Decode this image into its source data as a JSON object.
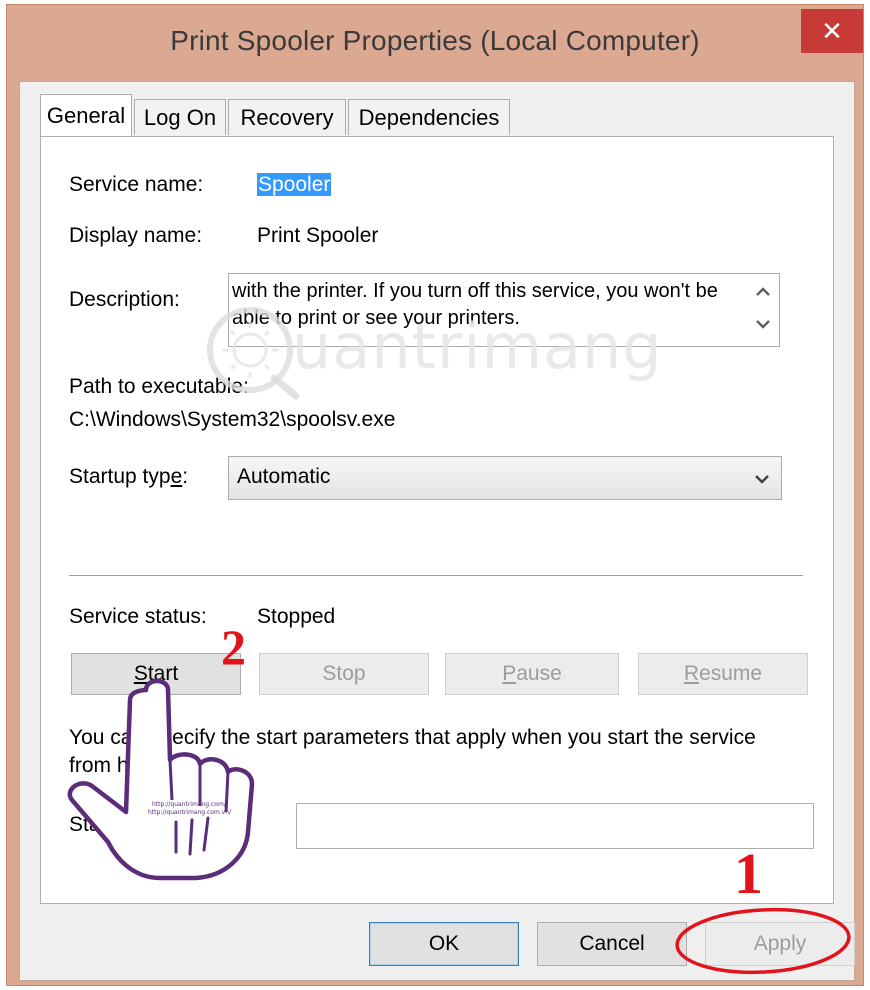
{
  "window": {
    "title": "Print Spooler Properties (Local Computer)",
    "close_label": "✕"
  },
  "tabs": [
    {
      "label": "General",
      "active": true
    },
    {
      "label": "Log On",
      "active": false
    },
    {
      "label": "Recovery",
      "active": false
    },
    {
      "label": "Dependencies",
      "active": false
    }
  ],
  "general": {
    "service_name_label": "Service name:",
    "service_name_value": "Spooler",
    "display_name_label": "Display name:",
    "display_name_value": "Print Spooler",
    "description_label": "Description:",
    "description_text": "with the printer.  If you turn off this service, you won't be able to print or see your printers.",
    "path_label": "Path to executable:",
    "path_value": "C:\\Windows\\System32\\spoolsv.exe",
    "startup_type_label_pre": "Startup typ",
    "startup_type_label_accel": "e",
    "startup_type_label_post": ":",
    "startup_type_value": "Automatic",
    "service_status_label": "Service status:",
    "service_status_value": "Stopped",
    "buttons": {
      "start": {
        "accel": "S",
        "rest": "tart"
      },
      "stop": {
        "accel": "",
        "rest": "Stop"
      },
      "pause": {
        "accel": "P",
        "rest": "ause"
      },
      "resume": {
        "accel": "R",
        "rest": "esume"
      }
    },
    "params_hint_line1": "You can specify the start parameters that apply when you start the service",
    "params_hint_line2": "from here.",
    "params_label": "Start parameters:",
    "params_value": ""
  },
  "footer": {
    "ok_label": "OK",
    "cancel_label": "Cancel",
    "apply_label": "Apply"
  },
  "annotations": {
    "step1": "1",
    "step2": "2",
    "watermark_text": "uantrimang",
    "hand_caption_line1": "http://quantrimang.com/",
    "hand_caption_line2": "http://quantrimang.com.vn/",
    "color": "#e2141b"
  }
}
